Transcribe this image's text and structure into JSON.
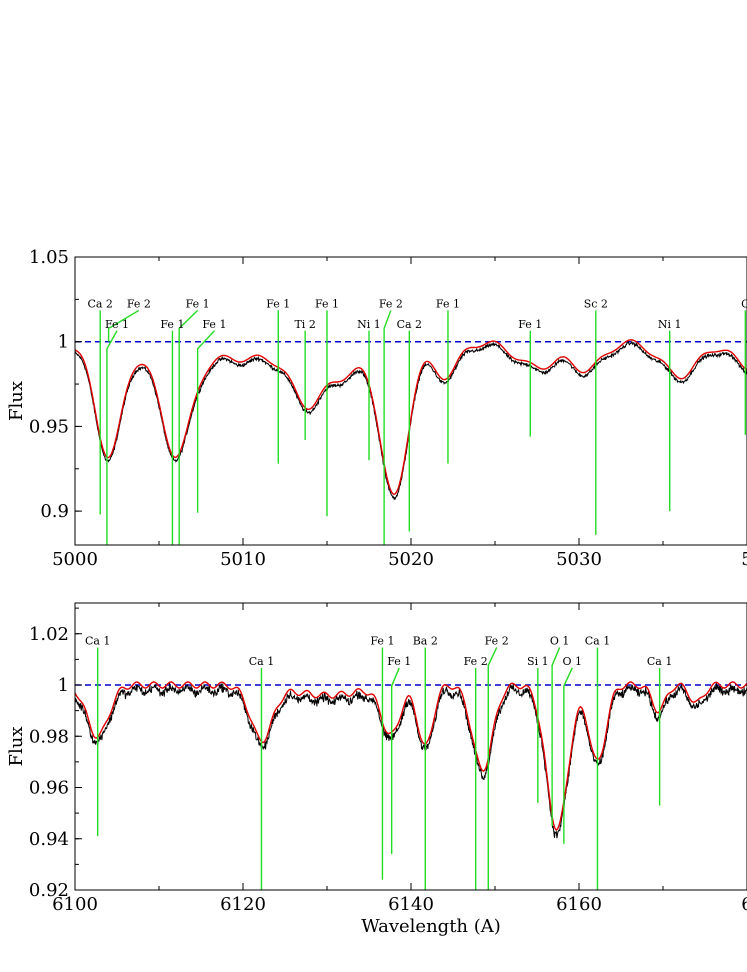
{
  "chart_data": [
    {
      "type": "line",
      "xlabel": "",
      "ylabel": "Flux",
      "xlim": [
        5000,
        5040
      ],
      "ylim": [
        0.88,
        1.05
      ],
      "xticks": [
        5000,
        5010,
        5020,
        5030,
        5040
      ],
      "xtick_labels": [
        "5000",
        "5010",
        "5020",
        "5030",
        "5"
      ],
      "yticks": [
        0.9,
        0.95,
        1.0,
        1.05
      ],
      "ytick_labels": [
        "0.9",
        "0.95",
        "1",
        "1.05"
      ],
      "continuum": 1.0,
      "observed_color": "#000000",
      "model_color": "#e00000",
      "continuum_color": "#0000cc",
      "line_color": "#22dd22",
      "features": [
        {
          "x": 5010,
          "d": 0.01,
          "w": 4.5
        },
        {
          "x": 5002.0,
          "d": 0.065,
          "w": 0.8
        },
        {
          "x": 5006.0,
          "d": 0.06,
          "w": 0.9
        },
        {
          "x": 5013.8,
          "d": 0.028,
          "w": 0.9
        },
        {
          "x": 5019.0,
          "d": 0.09,
          "w": 0.8
        },
        {
          "x": 5016,
          "d": 0.015,
          "w": 1.2
        },
        {
          "x": 5022,
          "d": 0.02,
          "w": 0.8
        },
        {
          "x": 5027.5,
          "d": 0.015,
          "w": 1.2
        },
        {
          "x": 5030.5,
          "d": 0.016,
          "w": 0.9
        },
        {
          "x": 5036.0,
          "d": 0.02,
          "w": 1.1
        },
        {
          "x": 5040,
          "d": 0.015,
          "w": 0.8
        }
      ],
      "spectral_lines": [
        {
          "label": "Ca 2",
          "x": 5001.5,
          "y_bottom": 0.898,
          "lx": 5001.5,
          "ly": 1.022
        },
        {
          "label": "Fe 1",
          "x": 5001.9,
          "y_bottom": 0.878,
          "lx": 5002.5,
          "ly": 1.01
        },
        {
          "label": "Fe 2",
          "x": 5002.0,
          "y_bottom": 1.0,
          "lx": 5003.8,
          "ly": 1.022
        },
        {
          "label": "Fe 1",
          "x": 5005.8,
          "y_bottom": 0.878,
          "lx": 5005.8,
          "ly": 1.01
        },
        {
          "label": "Fe 1",
          "x": 5006.2,
          "y_bottom": 0.878,
          "lx": 5007.3,
          "ly": 1.022
        },
        {
          "label": "Fe 1",
          "x": 5007.3,
          "y_bottom": 0.899,
          "lx": 5008.3,
          "ly": 1.01
        },
        {
          "label": "Fe 1",
          "x": 5012.1,
          "y_bottom": 0.928,
          "lx": 5012.1,
          "ly": 1.022
        },
        {
          "label": "Ti 2",
          "x": 5013.7,
          "y_bottom": 0.942,
          "lx": 5013.7,
          "ly": 1.01
        },
        {
          "label": "Fe 1",
          "x": 5015.0,
          "y_bottom": 0.897,
          "lx": 5015.0,
          "ly": 1.022
        },
        {
          "label": "Ni 1",
          "x": 5017.5,
          "y_bottom": 0.93,
          "lx": 5017.5,
          "ly": 1.01
        },
        {
          "label": "Fe 2",
          "x": 5018.4,
          "y_bottom": 0.878,
          "lx": 5018.8,
          "ly": 1.022
        },
        {
          "label": "Ca 2",
          "x": 5019.9,
          "y_bottom": 0.888,
          "lx": 5019.9,
          "ly": 1.01
        },
        {
          "label": "Fe 1",
          "x": 5022.2,
          "y_bottom": 0.928,
          "lx": 5022.2,
          "ly": 1.022
        },
        {
          "label": "Fe 1",
          "x": 5027.1,
          "y_bottom": 0.944,
          "lx": 5027.1,
          "ly": 1.01
        },
        {
          "label": "Sc 2",
          "x": 5031.0,
          "y_bottom": 0.886,
          "lx": 5031.0,
          "ly": 1.022
        },
        {
          "label": "Ni 1",
          "x": 5035.4,
          "y_bottom": 0.9,
          "lx": 5035.4,
          "ly": 1.01
        },
        {
          "label": "C",
          "x": 5039.9,
          "y_bottom": 0.945,
          "lx": 5039.9,
          "ly": 1.022
        }
      ]
    },
    {
      "type": "line",
      "xlabel": "Wavelength (A)",
      "ylabel": "Flux",
      "xlim": [
        6100,
        6180
      ],
      "ylim": [
        0.92,
        1.032
      ],
      "xticks": [
        6100,
        6120,
        6140,
        6160,
        6180
      ],
      "xtick_labels": [
        "6100",
        "6120",
        "6140",
        "6160",
        "6"
      ],
      "yticks": [
        0.92,
        0.94,
        0.96,
        0.98,
        1.0,
        1.02
      ],
      "ytick_labels": [
        "0.92",
        "0.94",
        "0.96",
        "0.98",
        "1",
        "1.02"
      ],
      "continuum": 1.0,
      "observed_color": "#000000",
      "model_color": "#e00000",
      "continuum_color": "#0000cc",
      "line_color": "#22dd22",
      "features": [
        {
          "x": 6102.7,
          "d": 0.02,
          "w": 1.3
        },
        {
          "x": 6122.2,
          "d": 0.021,
          "w": 1.3
        },
        {
          "x": 6130,
          "d": 0.004,
          "w": 4.0
        },
        {
          "x": 6137.6,
          "d": 0.019,
          "w": 1.1
        },
        {
          "x": 6141.7,
          "d": 0.024,
          "w": 0.9
        },
        {
          "x": 6148.5,
          "d": 0.033,
          "w": 1.2
        },
        {
          "x": 6157.4,
          "d": 0.056,
          "w": 1.3
        },
        {
          "x": 6162.2,
          "d": 0.03,
          "w": 1.0
        },
        {
          "x": 6169.5,
          "d": 0.01,
          "w": 0.8
        },
        {
          "x": 6174,
          "d": 0.007,
          "w": 0.8
        }
      ],
      "spectral_lines": [
        {
          "label": "Ca 1",
          "x": 6102.7,
          "y_bottom": 0.941,
          "lx": 6102.7,
          "ly": 1.017
        },
        {
          "label": "Ca 1",
          "x": 6122.2,
          "y_bottom": 0.92,
          "lx": 6122.2,
          "ly": 1.009
        },
        {
          "label": "Fe 1",
          "x": 6136.6,
          "y_bottom": 0.924,
          "lx": 6136.6,
          "ly": 1.017
        },
        {
          "label": "Fe 1",
          "x": 6137.7,
          "y_bottom": 0.934,
          "lx": 6138.6,
          "ly": 1.009
        },
        {
          "label": "Ba 2",
          "x": 6141.7,
          "y_bottom": 0.92,
          "lx": 6141.7,
          "ly": 1.017
        },
        {
          "label": "Fe 2",
          "x": 6147.7,
          "y_bottom": 0.92,
          "lx": 6147.7,
          "ly": 1.009
        },
        {
          "label": "Fe 2",
          "x": 6149.2,
          "y_bottom": 0.92,
          "lx": 6150.2,
          "ly": 1.017
        },
        {
          "label": "Si 1",
          "x": 6155.1,
          "y_bottom": 0.954,
          "lx": 6155.1,
          "ly": 1.009
        },
        {
          "label": "O 1",
          "x": 6156.8,
          "y_bottom": 0.945,
          "lx": 6157.7,
          "ly": 1.017
        },
        {
          "label": "O 1",
          "x": 6158.2,
          "y_bottom": 0.938,
          "lx": 6159.2,
          "ly": 1.009
        },
        {
          "label": "Ca 1",
          "x": 6162.2,
          "y_bottom": 0.92,
          "lx": 6162.2,
          "ly": 1.017
        },
        {
          "label": "Ca 1",
          "x": 6169.6,
          "y_bottom": 0.953,
          "lx": 6169.6,
          "ly": 1.009
        }
      ]
    }
  ]
}
